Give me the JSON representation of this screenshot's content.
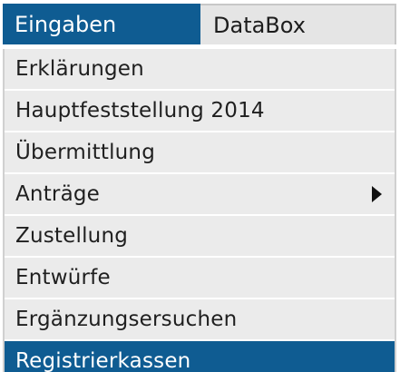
{
  "tabs": [
    {
      "label": "Eingaben",
      "active": true
    },
    {
      "label": "DataBox",
      "active": false
    }
  ],
  "menu": {
    "items": [
      {
        "label": "Erklärungen"
      },
      {
        "label": "Hauptfeststellung 2014"
      },
      {
        "label": "Übermittlung"
      },
      {
        "label": "Anträge",
        "has_submenu": true,
        "submenu_icon": "chevron-right-icon"
      },
      {
        "label": "Zustellung"
      },
      {
        "label": "Entwürfe"
      },
      {
        "label": "Ergänzungsersuchen"
      },
      {
        "label": "Registrierkassen",
        "selected": true
      }
    ]
  },
  "colors": {
    "active_tab_background": "#0f5c92",
    "active_tab_text": "#ffffff",
    "inactive_tab_background": "#e5e5e5",
    "menu_item_background": "#ebebeb",
    "menu_text": "#1f1f1f",
    "selected_item_background": "#0f5c92"
  }
}
